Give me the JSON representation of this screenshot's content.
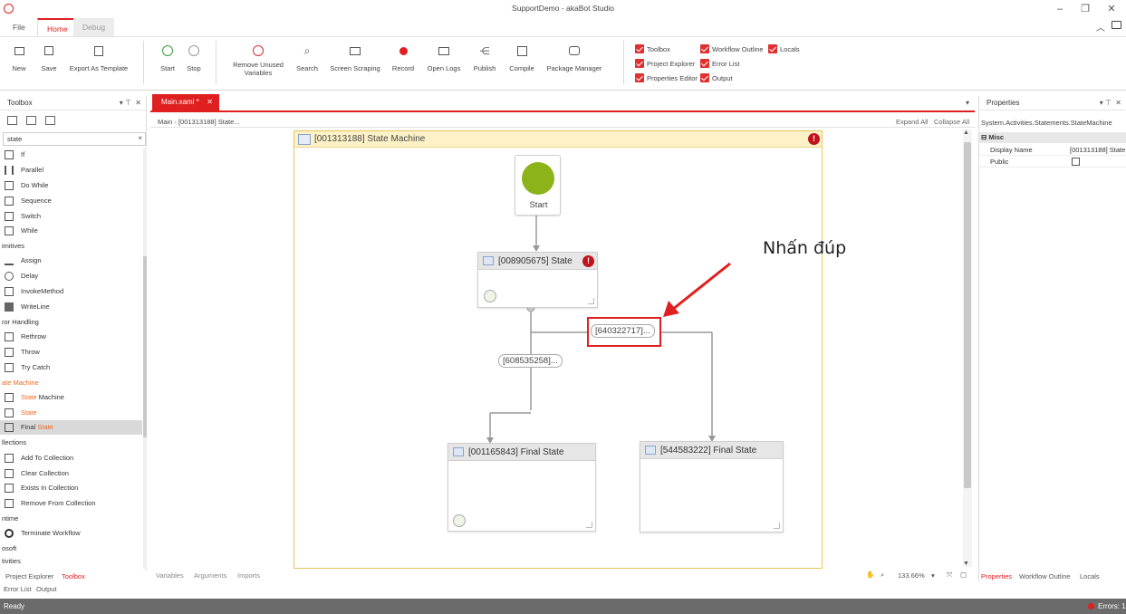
{
  "window": {
    "title": "SupportDemo - akaBot Studio"
  },
  "tabs": [
    {
      "label": "File"
    },
    {
      "label": "Home"
    },
    {
      "label": "Debug"
    }
  ],
  "ribbon": {
    "new": "New",
    "save": "Save",
    "export": "Export As Template",
    "start": "Start",
    "stop": "Stop",
    "remove_unused": "Remove Unused Variables",
    "search": "Search",
    "screen_scraping": "Screen Scraping",
    "record": "Record",
    "open_logs": "Open Logs",
    "publish": "Publish",
    "compile": "Compile",
    "package_manager": "Package Manager"
  },
  "view_checks": {
    "toolbox": "Toolbox",
    "workflow_outline": "Workflow Outline",
    "locals": "Locals",
    "project_explorer": "Project Explorer",
    "error_list": "Error List",
    "properties_editor": "Properties Editor",
    "output": "Output"
  },
  "toolbox": {
    "title": "Toolbox",
    "search_value": "state",
    "items": [
      {
        "label": "If"
      },
      {
        "label": "Parallel"
      },
      {
        "label": "Do While"
      },
      {
        "label": "Sequence"
      },
      {
        "label": "Switch"
      },
      {
        "label": "While"
      },
      {
        "label": "imitives"
      },
      {
        "label": "Assign"
      },
      {
        "label": "Delay"
      },
      {
        "label": "InvokeMethod"
      },
      {
        "label": "WriteLine"
      },
      {
        "label": "ror Handling"
      },
      {
        "label": "Rethrow"
      },
      {
        "label": "Throw"
      },
      {
        "label": "Try Catch"
      },
      {
        "label": "ate Machine"
      },
      {
        "label": "State"
      },
      {
        "label": "Machine"
      },
      {
        "label": "State"
      },
      {
        "label": "Final"
      },
      {
        "label": "State"
      },
      {
        "label": "llections"
      },
      {
        "label": "Add To Collection"
      },
      {
        "label": "Clear Collection"
      },
      {
        "label": "Exists In Collection"
      },
      {
        "label": "Remove From Collection"
      },
      {
        "label": "ntime"
      },
      {
        "label": "Terminate Workflow"
      },
      {
        "label": "osoft"
      },
      {
        "label": "tivities"
      }
    ]
  },
  "doc_tab": {
    "label": "Main.xaml *"
  },
  "breadcrumb": {
    "root": "Main",
    "current": "[001313188] State..."
  },
  "designer_actions": {
    "expand_all": "Expand All",
    "collapse_all": "Collapse All"
  },
  "state_machine": {
    "title": "[001313188] State Machine"
  },
  "nodes": {
    "start": "Start",
    "state1": "[008905675] State",
    "final1": "[001165843] Final State",
    "final2": "[544583222] Final State"
  },
  "transitions": {
    "t1": "[640322717]...",
    "t2": "[608535258]..."
  },
  "annotation": "Nhấn đúp",
  "designer_footer": {
    "variables": "Variables",
    "arguments": "Arguments",
    "imports": "Imports",
    "zoom": "133.66%"
  },
  "properties": {
    "title": "Properties",
    "type": "System.Activities.Statements.StateMachine",
    "category": "Misc",
    "rows": [
      {
        "name": "Display Name",
        "value": "[001313188] State"
      },
      {
        "name": "Public",
        "value": ""
      }
    ]
  },
  "bottom_tabs": {
    "project_explorer": "Project Explorer",
    "toolbox": "Toolbox",
    "error_list": "Error List",
    "output": "Output",
    "properties": "Properties",
    "workflow_outline": "Workflow Outline",
    "locals": "Locals"
  },
  "status": {
    "ready": "Ready",
    "errors": "Errors: 1"
  },
  "colors": {
    "accent": "#e02020",
    "start_node": "#8cb31a",
    "error": "#c0131b",
    "statemachine_header": "#fdf2c7"
  }
}
